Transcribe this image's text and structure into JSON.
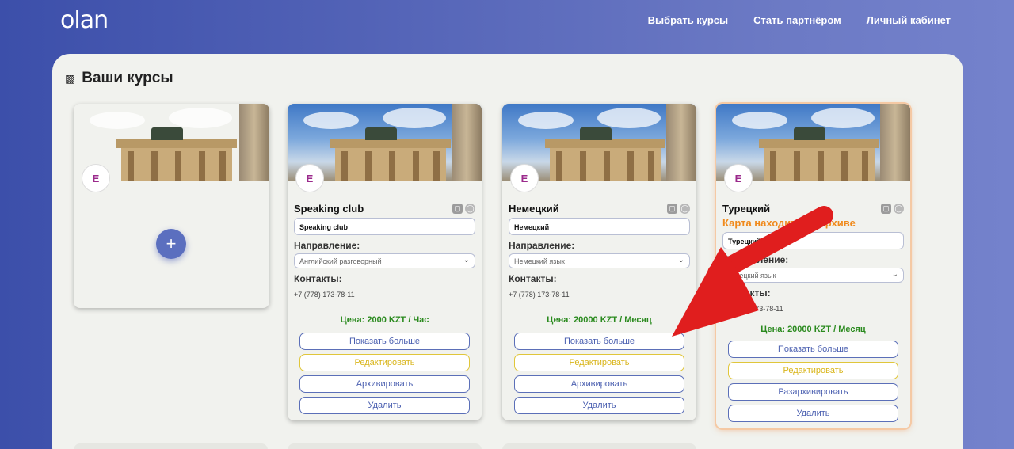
{
  "header": {
    "logo": "olan",
    "nav": [
      "Выбрать курсы",
      "Стать партнёром",
      "Личный кабинет"
    ]
  },
  "page": {
    "title": "Ваши курсы"
  },
  "add_card": {
    "button": "+"
  },
  "cards": [
    {
      "name": "Speaking club",
      "field_value": "Speaking club",
      "direction_label": "Направление:",
      "direction_value": "Английский разговорный",
      "contacts_label": "Контакты:",
      "phone": "+7 (778) 173-78-11",
      "price": "Цена: 2000 KZT / Час",
      "buttons": [
        "Показать больше",
        "Редактировать",
        "Архивировать",
        "Удалить"
      ]
    },
    {
      "name": "Немецкий",
      "field_value": "Немецкий",
      "direction_label": "Направление:",
      "direction_value": "Немецкий язык",
      "contacts_label": "Контакты:",
      "phone": "+7 (778) 173-78-11",
      "price": "Цена: 20000 KZT / Месяц",
      "buttons": [
        "Показать больше",
        "Редактировать",
        "Архивировать",
        "Удалить"
      ]
    },
    {
      "name": "Турецкий",
      "archived_note": "Карта находится в архиве",
      "field_value": "Турецкий",
      "direction_label": "Направление:",
      "direction_value": "Турецкий язык",
      "contacts_label": "Контакты:",
      "phone": "+7 (778) 173-78-11",
      "price": "Цена: 20000 KZT / Месяц",
      "buttons": [
        "Показать больше",
        "Редактировать",
        "Разархивировать",
        "Удалить"
      ]
    }
  ],
  "colors": {
    "accent": "#5b6fbf",
    "price": "#2a8a1e",
    "edit": "#e0c63a",
    "archived_note": "#f08a1c",
    "arrow": "#e01e1e"
  }
}
